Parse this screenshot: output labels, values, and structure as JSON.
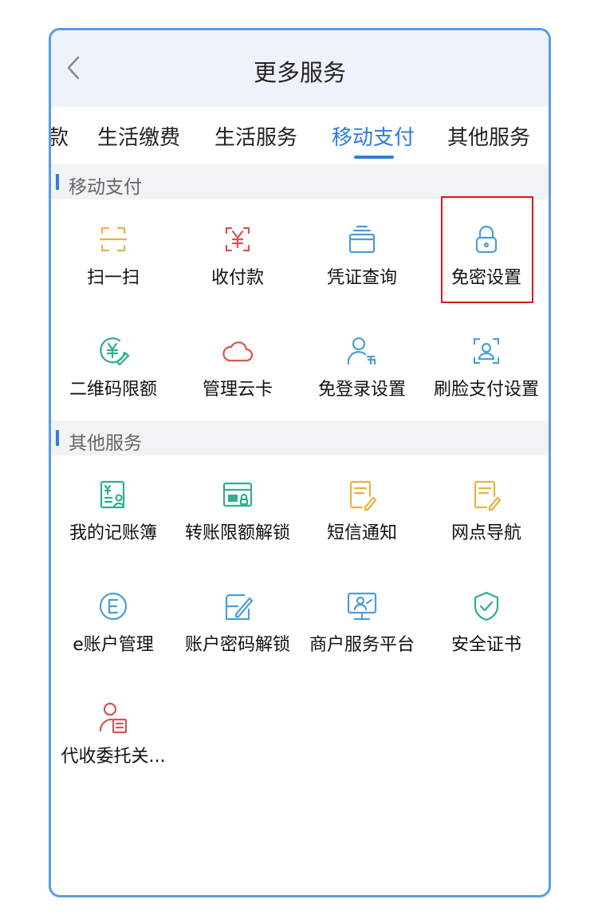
{
  "header": {
    "title": "更多服务",
    "back_icon": "chevron-left-icon"
  },
  "tabs": [
    {
      "label": "款",
      "active": false
    },
    {
      "label": "生活缴费",
      "active": false
    },
    {
      "label": "生活服务",
      "active": false
    },
    {
      "label": "移动支付",
      "active": true
    },
    {
      "label": "其他服务",
      "active": false
    }
  ],
  "sections": [
    {
      "title": "移动支付",
      "items": [
        {
          "label": "扫一扫",
          "icon": "scan-icon",
          "color": "#e8b33c"
        },
        {
          "label": "收付款",
          "icon": "yuan-frame-icon",
          "color": "#d9534f"
        },
        {
          "label": "凭证查询",
          "icon": "voucher-icon",
          "color": "#4a9fd8"
        },
        {
          "label": "免密设置",
          "icon": "lock-icon",
          "color": "#4a9fd8",
          "highlighted": true
        },
        {
          "label": "二维码限额",
          "icon": "yuan-circle-icon",
          "color": "#2fae8e"
        },
        {
          "label": "管理云卡",
          "icon": "cloud-icon",
          "color": "#d9534f"
        },
        {
          "label": "免登录设置",
          "icon": "user-free-icon",
          "color": "#4a9fd8"
        },
        {
          "label": "刷脸支付设置",
          "icon": "face-scan-icon",
          "color": "#4a9fd8"
        }
      ]
    },
    {
      "title": "其他服务",
      "items": [
        {
          "label": "我的记账簿",
          "icon": "ledger-icon",
          "color": "#2fae8e"
        },
        {
          "label": "转账限额解锁",
          "icon": "card-lock-icon",
          "color": "#2fae8e"
        },
        {
          "label": "短信通知",
          "icon": "sms-icon",
          "color": "#e8b33c"
        },
        {
          "label": "网点导航",
          "icon": "note-icon",
          "color": "#e8b33c"
        },
        {
          "label": "e账户管理",
          "icon": "e-circle-icon",
          "color": "#4a9fd8"
        },
        {
          "label": "账户密码解锁",
          "icon": "edit-icon",
          "color": "#4a9fd8"
        },
        {
          "label": "商户服务平台",
          "icon": "monitor-user-icon",
          "color": "#4a9fd8"
        },
        {
          "label": "安全证书",
          "icon": "shield-check-icon",
          "color": "#2fae8e"
        },
        {
          "label": "代收委托关...",
          "icon": "user-bill-icon",
          "color": "#d9534f"
        }
      ]
    }
  ]
}
